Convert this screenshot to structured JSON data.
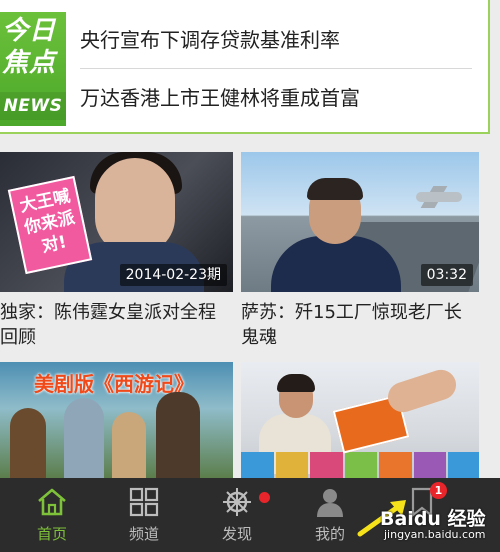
{
  "today": {
    "logo": {
      "line1": "今日",
      "line2": "焦点",
      "line3": "NEWS"
    },
    "headlines": [
      "央行宣布下调存贷款基准利率",
      "万达香港上市王健林将重成首富"
    ]
  },
  "cards": [
    {
      "caption": "独家：陈伟霆女皇派对全程回顾",
      "badge": "2014-02-23期",
      "art_text": "大王喊你来派对!"
    },
    {
      "caption": "萨苏：歼15工厂惊现老厂长鬼魂",
      "badge": "03:32"
    },
    {
      "caption": "",
      "badge": "",
      "art_text": "美剧版《西游记》"
    },
    {
      "caption": "",
      "badge": ""
    }
  ],
  "bottom_nav": {
    "items": [
      {
        "label": "首页",
        "icon": "home-icon",
        "active": true
      },
      {
        "label": "频道",
        "icon": "grid-icon",
        "active": false
      },
      {
        "label": "发现",
        "icon": "helm-icon",
        "active": false
      },
      {
        "label": "我的",
        "icon": "user-icon",
        "active": false
      },
      {
        "label": "",
        "icon": "bookmark-icon",
        "active": false,
        "badge": "1"
      }
    ]
  },
  "watermark": {
    "title": "Baidu 经验",
    "url": "jingyan.baidu.com"
  },
  "colors": {
    "accent": "#7ec23a",
    "nav_bg": "#2c2c2c",
    "badge_red": "#e8252a",
    "logo_green": "#5bb531"
  }
}
